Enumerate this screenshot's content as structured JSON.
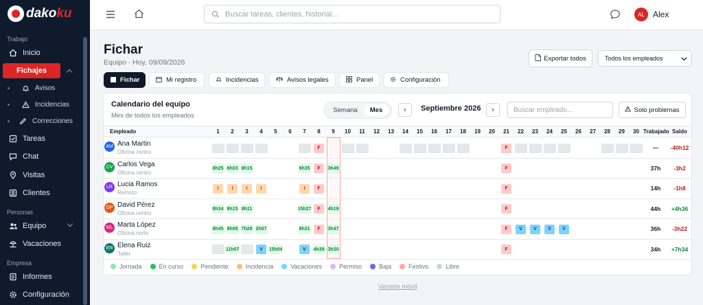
{
  "brand": {
    "name": "dako",
    "accent": "ku"
  },
  "colors": {
    "accent": "#dc2626",
    "sidebar": "#0f1b2d"
  },
  "sidebar": {
    "sections": {
      "work": "Trabajo",
      "people": "Personas",
      "company": "Empresa"
    },
    "items": {
      "inicio": "Inicio",
      "fichajes": "Fichajes",
      "avisos": "Avisos",
      "incidencias": "Incidencias",
      "correcciones": "Correcciones",
      "tareas": "Tareas",
      "chat": "Chat",
      "visitas": "Visitas",
      "clientes": "Clientes",
      "equipo": "Equipo",
      "vacaciones": "Vacaciones",
      "informes": "Informes",
      "configuracion": "Configuración"
    }
  },
  "header": {
    "search_placeholder": "Buscar tareas, clientes, historial...",
    "user_initials": "AL",
    "user_name": "Alex"
  },
  "page": {
    "title": "Fichar",
    "subtitle": "Equipo · Hoy, 09/09/2026",
    "export_label": "Exportar todos",
    "filter_value": "Todos los empleados"
  },
  "tabs": [
    "Fichar",
    "Mi registro",
    "Incidencias",
    "Avisos legales",
    "Panel",
    "Configuración"
  ],
  "calendar": {
    "title": "Calendario del equipo",
    "subtitle": "Mes de todos los empleados",
    "view_week": "Semana",
    "view_month": "Mes",
    "month": "Septiembre 2026",
    "search_placeholder": "Buscar empleado...",
    "problems_label": "Solo problemas",
    "col_employee": "Empleado",
    "col_worked": "Trabajado",
    "col_balance": "Saldo",
    "today": 9,
    "days": [
      "1",
      "2",
      "3",
      "4",
      "5",
      "6",
      "7",
      "8",
      "9",
      "10",
      "11",
      "12",
      "13",
      "14",
      "15",
      "16",
      "17",
      "18",
      "19",
      "20",
      "21",
      "22",
      "23",
      "24",
      "25",
      "26",
      "27",
      "28",
      "29",
      "30"
    ],
    "employees": [
      {
        "initials": "AM",
        "name": "Ana Martin",
        "location": "Oficina centro",
        "avatar": "#2563eb",
        "worked": "—",
        "balance": "-40h12",
        "balance_color": "#b91c1c",
        "cells": [
          "j",
          "j",
          "j",
          "j",
          "",
          "",
          "j",
          "F",
          "",
          "j",
          "j",
          "",
          "",
          "j",
          "j",
          "j",
          "j",
          "j",
          "",
          "",
          "F",
          "j",
          "j",
          "j",
          "j",
          "",
          "",
          "j",
          "j",
          "j"
        ]
      },
      {
        "initials": "CV",
        "name": "Carlos Vega",
        "location": "Oficina centro",
        "avatar": "#16a34a",
        "worked": "37h",
        "balance": "-3h2",
        "balance_color": "#b91c1c",
        "cells": [
          "8h25",
          "8h03",
          "8h15",
          "",
          "",
          "",
          "8h35",
          "F",
          "3h49",
          "",
          "",
          "",
          "",
          "",
          "",
          "",
          "",
          "",
          "",
          "",
          "F",
          "",
          "",
          "",
          "",
          "",
          "",
          "",
          "",
          ""
        ]
      },
      {
        "initials": "LR",
        "name": "Lucia Ramos",
        "location": "Remoto",
        "avatar": "#7c3aed",
        "worked": "14h",
        "balance": "-1h8",
        "balance_color": "#b91c1c",
        "cells": [
          "I",
          "I",
          "I",
          "I",
          "",
          "",
          "I",
          "F",
          "",
          "",
          "",
          "",
          "",
          "",
          "",
          "",
          "",
          "",
          "",
          "",
          "F",
          "",
          "",
          "",
          "",
          "",
          "",
          "",
          "",
          ""
        ]
      },
      {
        "initials": "DP",
        "name": "David Pérez",
        "location": "Oficina centro",
        "avatar": "#ea580c",
        "worked": "44h",
        "balance": "+4h36",
        "balance_color": "#15803d",
        "cells": [
          "8h34",
          "8h15",
          "8h11",
          "",
          "",
          "",
          "15h27",
          "F",
          "4h19",
          "",
          "",
          "",
          "",
          "",
          "",
          "",
          "",
          "",
          "",
          "",
          "F",
          "",
          "",
          "",
          "",
          "",
          "",
          "",
          "",
          ""
        ]
      },
      {
        "initials": "ML",
        "name": "Marta López",
        "location": "Oficina norte",
        "avatar": "#db2777",
        "worked": "36h",
        "balance": "-3h22",
        "balance_color": "#b91c1c",
        "cells": [
          "8h45",
          "8h08",
          "7h28",
          "2h07",
          "",
          "",
          "8h31",
          "F",
          "3h47",
          "",
          "",
          "",
          "",
          "",
          "",
          "",
          "",
          "",
          "",
          "",
          "F",
          "V",
          "V",
          "V",
          "V",
          "",
          "",
          "",
          "",
          ""
        ]
      },
      {
        "initials": "ER",
        "name": "Elena Ruiz",
        "location": "Taller",
        "avatar": "#0f766e",
        "worked": "34h",
        "balance": "+7h34",
        "balance_color": "#15803d",
        "cells": [
          "j",
          "11h07",
          "j",
          "V",
          "15h04",
          "",
          "V",
          "4h39",
          "3h30",
          "",
          "",
          "",
          "",
          "",
          "",
          "",
          "",
          "",
          "",
          "",
          "F",
          "",
          "",
          "",
          "",
          "",
          "",
          "",
          "",
          ""
        ]
      }
    ],
    "legend": [
      {
        "label": "Jornada",
        "color": "#86efac"
      },
      {
        "label": "En curso",
        "color": "#22c55e"
      },
      {
        "label": "Pendiente",
        "color": "#fcd34d"
      },
      {
        "label": "Incidencia",
        "color": "#fdba74"
      },
      {
        "label": "Vacaciones",
        "color": "#7dd3fc"
      },
      {
        "label": "Permiso",
        "color": "#d8b4fe"
      },
      {
        "label": "Baja",
        "color": "#6366f1"
      },
      {
        "label": "Festivo",
        "color": "#fca5a5"
      },
      {
        "label": "Libre",
        "color": "#d1d5db"
      }
    ]
  },
  "footer": {
    "mobile": "Versión móvil"
  }
}
